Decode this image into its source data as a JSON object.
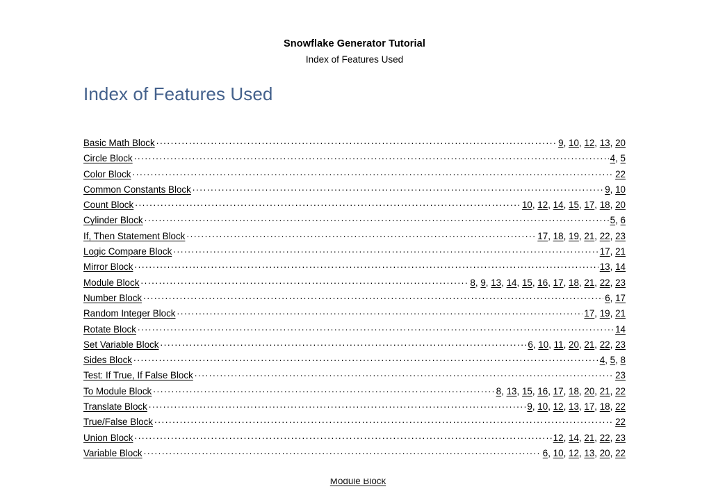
{
  "header": {
    "title": "Snowflake Generator Tutorial",
    "subtitle": "Index of Features Used"
  },
  "heading": "Index of Features Used",
  "colors": {
    "heading": "#44618C",
    "text": "#000000",
    "page_background": "#FFFFFF"
  },
  "index": {
    "entries": [
      {
        "name": "Basic Math Block",
        "pages": "9, 10, 12, 13, 20"
      },
      {
        "name": "Circle Block",
        "pages": "4, 5"
      },
      {
        "name": "Color Block",
        "pages": "22"
      },
      {
        "name": "Common Constants Block",
        "pages": "9, 10"
      },
      {
        "name": "Count Block",
        "pages": "10, 12, 14, 15, 17, 18, 20"
      },
      {
        "name": "Cylinder Block",
        "pages": "5, 6"
      },
      {
        "name": "If, Then Statement Block",
        "pages": "17, 18, 19, 21, 22, 23"
      },
      {
        "name": "Logic Compare Block",
        "pages": "17, 21"
      },
      {
        "name": "Mirror Block",
        "pages": "13, 14"
      },
      {
        "name": "Module Block",
        "pages": "8, 9, 13, 14, 15, 16, 17, 18, 21, 22, 23"
      },
      {
        "name": "Number Block",
        "pages": "6, 17"
      },
      {
        "name": "Random Integer Block",
        "pages": "17, 19, 21"
      },
      {
        "name": "Rotate Block",
        "pages": "14"
      },
      {
        "name": "Set Variable Block",
        "pages": "6, 10, 11, 20, 21, 22, 23"
      },
      {
        "name": "Sides Block",
        "pages": "4, 5, 8"
      },
      {
        "name": "Test: If True, If False Block",
        "pages": "23"
      },
      {
        "name": "To Module Block",
        "pages": "8, 13, 15, 16, 17, 18, 20, 21, 22"
      },
      {
        "name": "Translate Block",
        "pages": "9, 10, 12, 13, 17, 18, 22"
      },
      {
        "name": "True/False Block",
        "pages": "22"
      },
      {
        "name": "Union Block",
        "pages": "12, 14, 21, 22, 23"
      },
      {
        "name": "Variable Block",
        "pages": "6, 10, 12, 13, 20, 22"
      }
    ]
  },
  "clipped_bottom_line": "Module Block"
}
